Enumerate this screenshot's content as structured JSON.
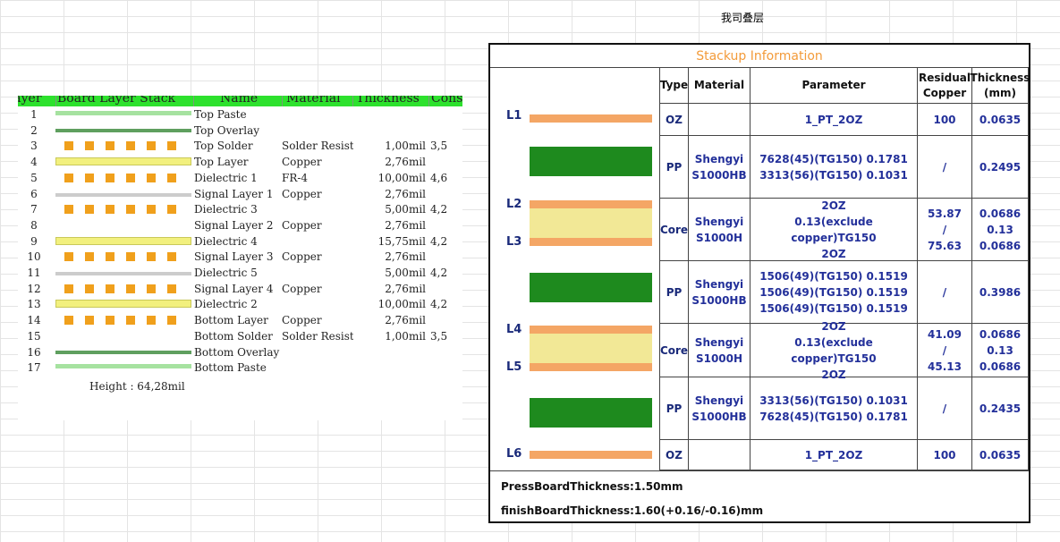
{
  "sheet_title": "我司叠层",
  "left_table": {
    "headers": [
      "Layer",
      "Board Layer Stack",
      "Name",
      "Material",
      "Thickness",
      "Constant"
    ],
    "rows": [
      {
        "num": "1",
        "visual": "paste",
        "name": "Top Paste",
        "material": "",
        "thickness": "",
        "constant": ""
      },
      {
        "num": "2",
        "visual": "overlay",
        "name": "Top Overlay",
        "material": "",
        "thickness": "",
        "constant": ""
      },
      {
        "num": "3",
        "visual": "pads",
        "name": "Top Solder",
        "material": "Solder Resist",
        "thickness": "1,00mil",
        "constant": "3,5"
      },
      {
        "num": "4",
        "visual": "yellow",
        "name": "Top Layer",
        "material": "Copper",
        "thickness": "2,76mil",
        "constant": ""
      },
      {
        "num": "5",
        "visual": "pads",
        "name": "Dielectric 1",
        "material": "FR-4",
        "thickness": "10,00mil",
        "constant": "4,6"
      },
      {
        "num": "6",
        "visual": "grey",
        "name": "Signal Layer 1",
        "material": "Copper",
        "thickness": "2,76mil",
        "constant": ""
      },
      {
        "num": "7",
        "visual": "pads",
        "name": "Dielectric 3",
        "material": "",
        "thickness": "5,00mil",
        "constant": "4,2"
      },
      {
        "num": "8",
        "visual": "none",
        "name": "Signal Layer 2",
        "material": "Copper",
        "thickness": "2,76mil",
        "constant": ""
      },
      {
        "num": "9",
        "visual": "yellow",
        "name": "Dielectric 4",
        "material": "",
        "thickness": "15,75mil",
        "constant": "4,2"
      },
      {
        "num": "10",
        "visual": "pads",
        "name": "Signal Layer 3",
        "material": "Copper",
        "thickness": "2,76mil",
        "constant": ""
      },
      {
        "num": "11",
        "visual": "grey",
        "name": "Dielectric 5",
        "material": "",
        "thickness": "5,00mil",
        "constant": "4,2"
      },
      {
        "num": "12",
        "visual": "pads",
        "name": "Signal Layer 4",
        "material": "Copper",
        "thickness": "2,76mil",
        "constant": ""
      },
      {
        "num": "13",
        "visual": "yellow",
        "name": "Dielectric 2",
        "material": "",
        "thickness": "10,00mil",
        "constant": "4,2"
      },
      {
        "num": "14",
        "visual": "pads",
        "name": "Bottom Layer",
        "material": "Copper",
        "thickness": "2,76mil",
        "constant": ""
      },
      {
        "num": "15",
        "visual": "none",
        "name": "Bottom Solder",
        "material": "Solder Resist",
        "thickness": "1,00mil",
        "constant": "3,5"
      },
      {
        "num": "16",
        "visual": "overlay",
        "name": "Bottom Overlay",
        "material": "",
        "thickness": "",
        "constant": ""
      },
      {
        "num": "17",
        "visual": "paste",
        "name": "Bottom Paste",
        "material": "",
        "thickness": "",
        "constant": ""
      }
    ],
    "height_text": "Height : 64,28mil"
  },
  "stackup": {
    "title": "Stackup Information",
    "layer_labels": [
      "L1",
      "L2",
      "L3",
      "L4",
      "L5",
      "L6"
    ],
    "columns": [
      "Type",
      "Material",
      "Parameter",
      "Residual\nCopper",
      "Thickness\n(mm)"
    ],
    "rows": [
      {
        "type": "OZ",
        "material": "",
        "parameter": "1_PT_2OZ",
        "residual": "100",
        "thickness": "0.0635"
      },
      {
        "type": "PP",
        "material": "Shengyi\nS1000HB",
        "parameter": "7628(45)(TG150) 0.1781\n3313(56)(TG150) 0.1031",
        "residual": "/",
        "thickness": "0.2495"
      },
      {
        "type": "Core",
        "material": "Shengyi\nS1000H",
        "parameter": "2OZ\n0.13(exclude copper)TG150\n2OZ",
        "residual": "53.87\n/\n75.63",
        "thickness": "0.0686\n0.13\n0.0686"
      },
      {
        "type": "PP",
        "material": "Shengyi\nS1000HB",
        "parameter": "1506(49)(TG150) 0.1519\n1506(49)(TG150) 0.1519\n1506(49)(TG150) 0.1519",
        "residual": "/",
        "thickness": "0.3986"
      },
      {
        "type": "Core",
        "material": "Shengyi\nS1000H",
        "parameter": "2OZ\n0.13(exclude copper)TG150\n2OZ",
        "residual": "41.09\n/\n45.13",
        "thickness": "0.0686\n0.13\n0.0686"
      },
      {
        "type": "PP",
        "material": "Shengyi\nS1000HB",
        "parameter": "3313(56)(TG150) 0.1031\n7628(45)(TG150) 0.1781",
        "residual": "/",
        "thickness": "0.2435"
      },
      {
        "type": "OZ",
        "material": "",
        "parameter": "1_PT_2OZ",
        "residual": "100",
        "thickness": "0.0635"
      }
    ],
    "press_board_thickness": "PressBoardThickness:1.50mm",
    "finish_board_thickness": "finishBoardThickness:1.60(+0.16/-0.16)mm"
  },
  "colors": {
    "header_green": "#2de12d",
    "pad_orange": "#f0a01c",
    "copper_orange": "#f4a665",
    "prepreg_green": "#1e8a1e",
    "core_yellow": "#f2e896",
    "title_orange": "#f39b3a",
    "cell_blue": "#23309a"
  }
}
